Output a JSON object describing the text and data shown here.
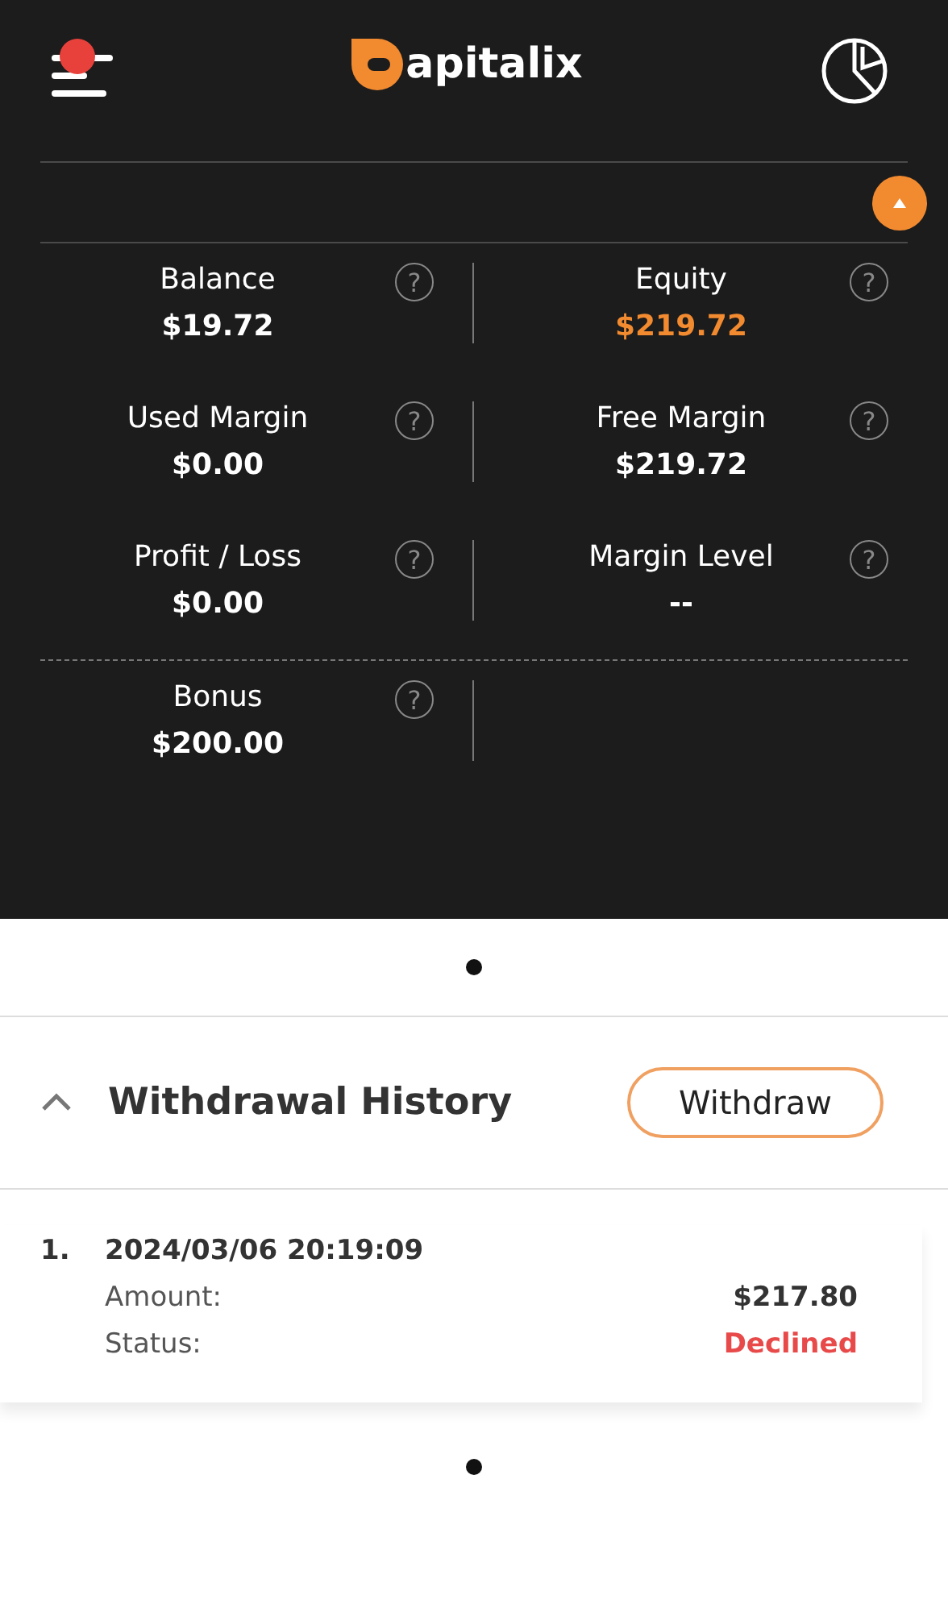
{
  "header": {
    "logo_text": "apitalix",
    "menu_notification": true
  },
  "summary": {
    "expanded": true,
    "metrics": [
      {
        "label": "Balance",
        "value": "$19.72",
        "help": "?",
        "highlight": false
      },
      {
        "label": "Equity",
        "value": "$219.72",
        "help": "?",
        "highlight": true
      },
      {
        "label": "Used Margin",
        "value": "$0.00",
        "help": "?",
        "highlight": false
      },
      {
        "label": "Free Margin",
        "value": "$219.72",
        "help": "?",
        "highlight": false
      },
      {
        "label": "Profit / Loss",
        "value": "$0.00",
        "help": "?",
        "highlight": false
      },
      {
        "label": "Margin Level",
        "value": "--",
        "help": "?",
        "highlight": false
      }
    ],
    "extra_metrics": [
      {
        "label": "Bonus",
        "value": "$200.00",
        "help": "?",
        "highlight": false
      }
    ]
  },
  "withdrawal_history": {
    "title": "Withdrawal History",
    "expanded": true,
    "button": "Withdraw",
    "entries": [
      {
        "index": "1.",
        "datetime": "2024/03/06 20:19:09",
        "amount_label": "Amount:",
        "amount": "$217.80",
        "status_label": "Status:",
        "status": "Declined",
        "color": "#e84a4a"
      }
    ]
  }
}
